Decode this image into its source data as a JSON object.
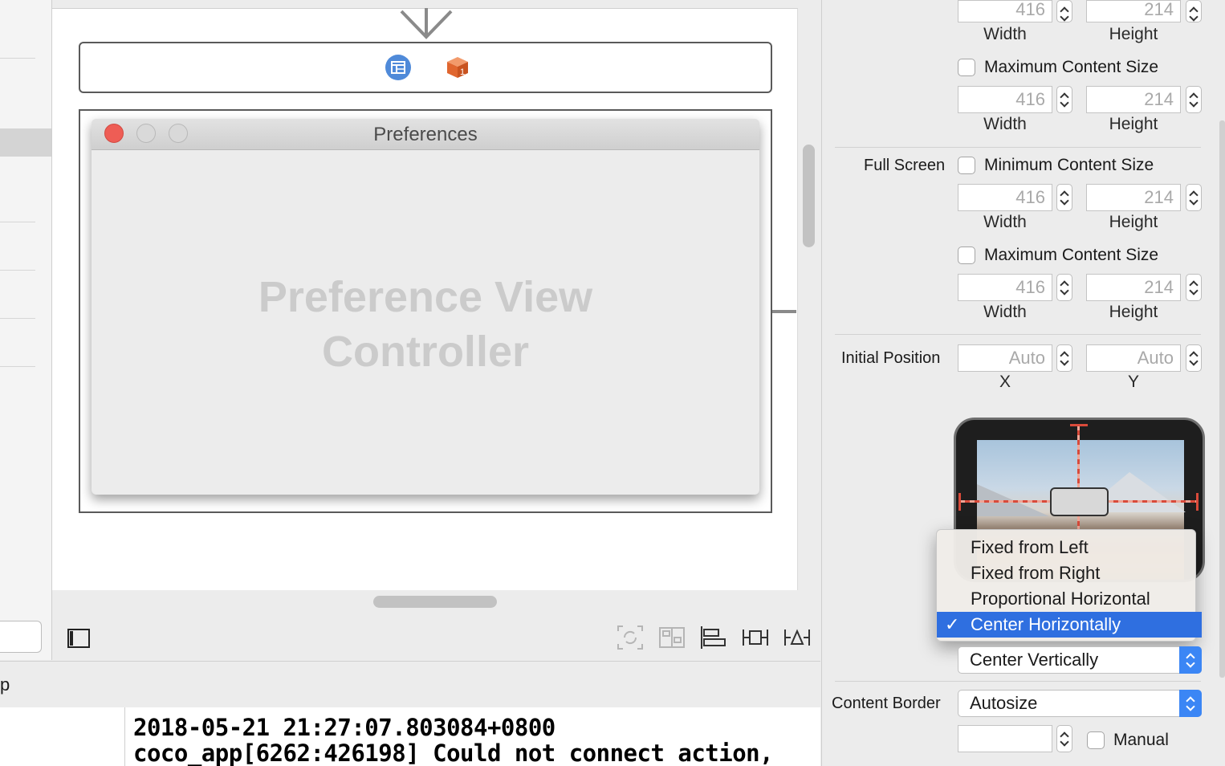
{
  "canvas": {
    "preferences_window": {
      "title": "Preferences",
      "placeholder_line1": "Preference View",
      "placeholder_line2": "Controller"
    }
  },
  "console": {
    "header_text": "p",
    "lines": [
      "2018-05-21 21:27:07.803084+0800",
      "coco_app[6262:426198] Could not connect action,"
    ]
  },
  "inspector": {
    "top_partial": {
      "width_value": "416",
      "height_value": "214",
      "width_label": "Width",
      "height_label": "Height"
    },
    "max_content_size_1": {
      "label": "Maximum Content Size",
      "width_value": "416",
      "height_value": "214",
      "width_label": "Width",
      "height_label": "Height"
    },
    "full_screen": {
      "label": "Full Screen",
      "min_label": "Minimum Content Size",
      "min_width": "416",
      "min_height": "214",
      "width_label": "Width",
      "height_label": "Height",
      "max_label": "Maximum Content Size",
      "max_width": "416",
      "max_height": "214",
      "max_width_label": "Width",
      "max_height_label": "Height"
    },
    "initial_position": {
      "label": "Initial Position",
      "x_placeholder": "Auto",
      "y_placeholder": "Auto",
      "x_label": "X",
      "y_label": "Y"
    },
    "horizontal_menu": {
      "items": [
        "Fixed from Left",
        "Fixed from Right",
        "Proportional Horizontal",
        "Center Horizontally"
      ],
      "selected": "Center Horizontally",
      "checkmark": "✓"
    },
    "vertical_popup": {
      "value": "Center Vertically"
    },
    "content_border": {
      "label": "Content Border",
      "value": "Autosize",
      "manual_label": "Manual"
    }
  },
  "colors": {
    "accent": "#3b86f5",
    "menu_selection": "#2f6fe0",
    "close_button": "#ee5d55",
    "guide_red": "#d94a3a"
  },
  "icons": {
    "window_controller": "window-controller-icon",
    "first_responder": "first-responder-cube-icon",
    "sidebar_toggle": "sidebar-toggle-icon",
    "update_frames": "update-frames-icon",
    "embed_in_stack": "embed-in-stack-icon",
    "align": "align-icon",
    "add_constraints": "add-constraints-icon",
    "resolve_auto_layout": "resolve-auto-layout-icon"
  }
}
